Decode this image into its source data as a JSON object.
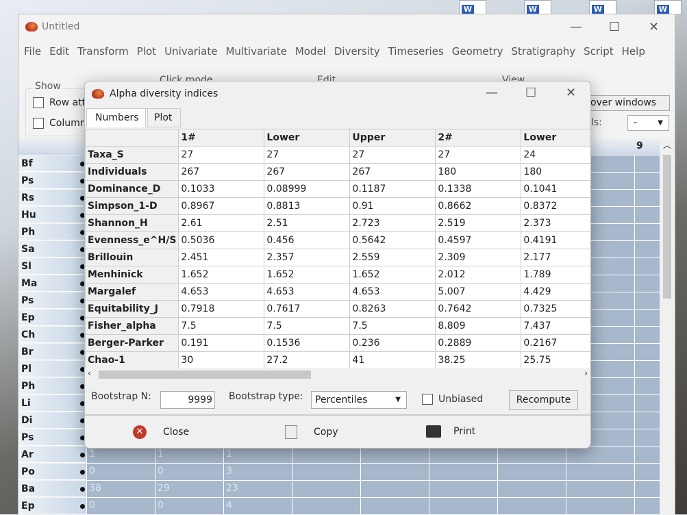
{
  "main_window": {
    "title": "Untitled",
    "menu": [
      "File",
      "Edit",
      "Transform",
      "Plot",
      "Univariate",
      "Multivariate",
      "Model",
      "Diversity",
      "Timeseries",
      "Geometry",
      "Stratigraphy",
      "Script",
      "Help"
    ],
    "groups": {
      "show": "Show",
      "click_mode": "Click mode",
      "edit": "Edit",
      "view": "View"
    },
    "row_attr": "Row attri",
    "column_attr": "Column a",
    "over_windows": "over windows",
    "labels_label": "ls:",
    "labels_value": "-",
    "col_header": "9",
    "row_headers": [
      "Bf",
      "Ps",
      "Rs",
      "Hu",
      "Ph",
      "Sa",
      "Sl",
      "Ma",
      "Ps",
      "Ep",
      "Ch",
      "Br",
      "Pl",
      "Ph",
      "Li",
      "Di",
      "Ps",
      "Ar",
      "Po",
      "Ba",
      "Ep"
    ],
    "visible_cells": [
      [
        "1",
        "1",
        "1"
      ],
      [
        "0",
        "0",
        "3"
      ],
      [
        "38",
        "29",
        "23"
      ],
      [
        "0",
        "0",
        "4"
      ]
    ]
  },
  "dialog": {
    "title": "Alpha diversity indices",
    "tabs": [
      "Numbers",
      "Plot"
    ],
    "columns": [
      "",
      "1#",
      "Lower",
      "Upper",
      "2#",
      "Lower"
    ],
    "rows": [
      [
        "Taxa_S",
        "27",
        "27",
        "27",
        "27",
        "24"
      ],
      [
        "Individuals",
        "267",
        "267",
        "267",
        "180",
        "180"
      ],
      [
        "Dominance_D",
        "0.1033",
        "0.08999",
        "0.1187",
        "0.1338",
        "0.1041"
      ],
      [
        "Simpson_1-D",
        "0.8967",
        "0.8813",
        "0.91",
        "0.8662",
        "0.8372"
      ],
      [
        "Shannon_H",
        "2.61",
        "2.51",
        "2.723",
        "2.519",
        "2.373"
      ],
      [
        "Evenness_e^H/S",
        "0.5036",
        "0.456",
        "0.5642",
        "0.4597",
        "0.4191"
      ],
      [
        "Brillouin",
        "2.451",
        "2.357",
        "2.559",
        "2.309",
        "2.177"
      ],
      [
        "Menhinick",
        "1.652",
        "1.652",
        "1.652",
        "2.012",
        "1.789"
      ],
      [
        "Margalef",
        "4.653",
        "4.653",
        "4.653",
        "5.007",
        "4.429"
      ],
      [
        "Equitability_J",
        "0.7918",
        "0.7617",
        "0.8263",
        "0.7642",
        "0.7325"
      ],
      [
        "Fisher_alpha",
        "7.5",
        "7.5",
        "7.5",
        "8.809",
        "7.437"
      ],
      [
        "Berger-Parker",
        "0.191",
        "0.1536",
        "0.236",
        "0.2889",
        "0.2167"
      ],
      [
        "Chao-1",
        "30",
        "27.2",
        "41",
        "38.25",
        "25.75"
      ]
    ],
    "bootstrap_n_label": "Bootstrap N:",
    "bootstrap_n": "9999",
    "bootstrap_type_label": "Bootstrap type:",
    "bootstrap_type": "Percentiles",
    "unbiased": "Unbiased",
    "recompute": "Recompute",
    "close": "Close",
    "copy": "Copy",
    "print": "Print"
  }
}
